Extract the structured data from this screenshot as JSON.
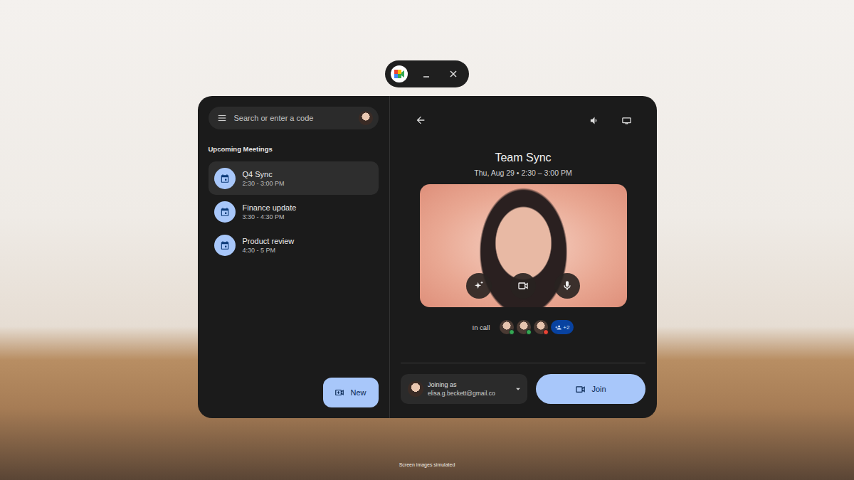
{
  "search": {
    "placeholder": "Search or enter a code"
  },
  "upcoming": {
    "heading": "Upcoming Meetings",
    "meetings": [
      {
        "title": "Q4 Sync",
        "time": "2:30 - 3:00 PM",
        "selected": true
      },
      {
        "title": "Finance update",
        "time": "3:30 - 4:30 PM",
        "selected": false
      },
      {
        "title": "Product review",
        "time": "4:30 - 5 PM",
        "selected": false
      }
    ]
  },
  "new_button": {
    "label": "New"
  },
  "meeting": {
    "title": "Team Sync",
    "when": "Thu, Aug 29 • 2:30 – 3:00 PM"
  },
  "in_call": {
    "label": "In call",
    "participants": [
      {
        "color": "#34a853"
      },
      {
        "color": "#34a853"
      },
      {
        "color": "#ea4335"
      }
    ],
    "more": "+2"
  },
  "account": {
    "label": "Joining as",
    "email": "elisa.g.beckett@gmail.co"
  },
  "join_button": {
    "label": "Join"
  },
  "caption": "Screen images simulated"
}
